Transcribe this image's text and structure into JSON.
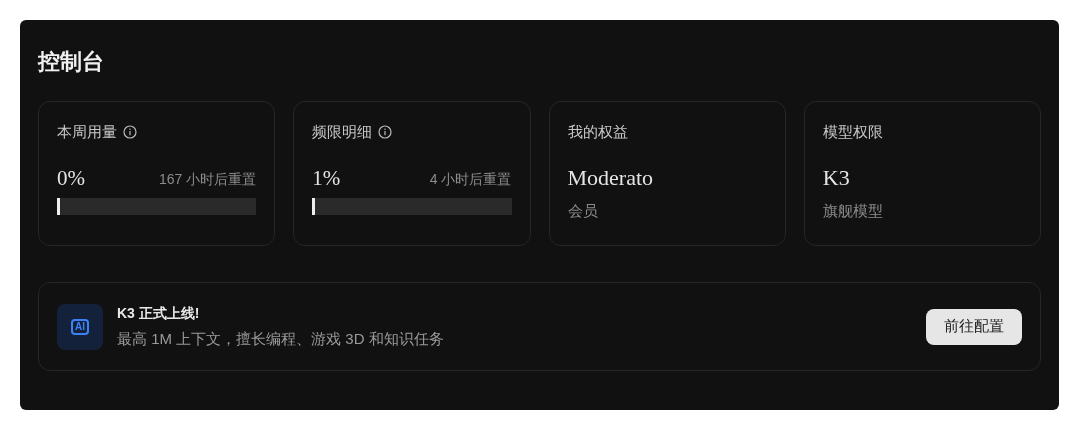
{
  "title": "控制台",
  "cards": [
    {
      "kind": "usage",
      "label": "本周用量",
      "info": true,
      "value": "0%",
      "reset": "167 小时后重置",
      "level": 0
    },
    {
      "kind": "usage",
      "label": "频限明细",
      "info": true,
      "value": "1%",
      "reset": "4 小时后重置",
      "level": 0.01
    },
    {
      "kind": "value",
      "label": "我的权益",
      "value": "Moderato",
      "sub": "会员"
    },
    {
      "kind": "value",
      "label": "模型权限",
      "value": "K3",
      "sub": "旗舰模型"
    }
  ],
  "banner": {
    "icon_text": "AI",
    "title": "K3 正式上线!",
    "text": "最高 1M 上下文，擅长编程、游戏 3D 和知识任务",
    "button": "前往配置"
  }
}
